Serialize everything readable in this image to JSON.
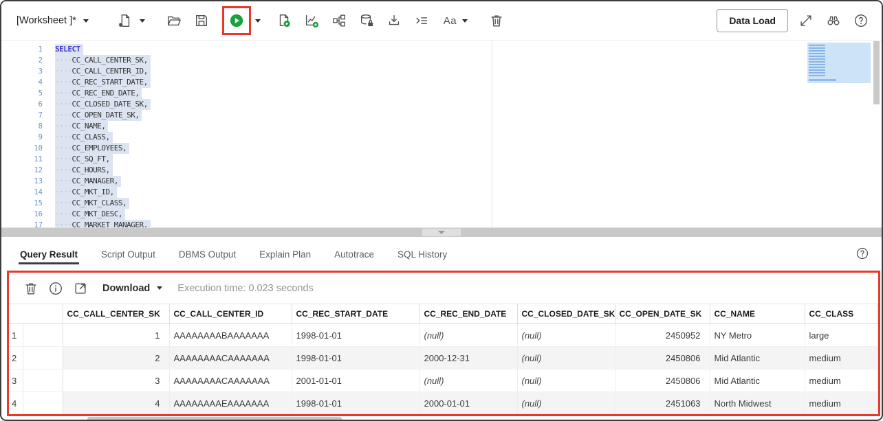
{
  "toolbar": {
    "worksheet_label": "[Worksheet ]*",
    "data_load_label": "Data Load",
    "font_toggle_label": "Aa",
    "icons": [
      "worksheet-dropdown",
      "new-worksheet",
      "open-file",
      "save",
      "run-statement",
      "run-dropdown",
      "run-script",
      "explain-plan",
      "autotrace",
      "dbms-output",
      "download-script",
      "format-code",
      "font-size",
      "clear-worksheet",
      "data-load",
      "expand",
      "find",
      "help"
    ]
  },
  "editor": {
    "indent": "····",
    "lines": [
      {
        "n": "1",
        "text": "SELECT"
      },
      {
        "n": "2",
        "text": "CC_CALL_CENTER_SK,"
      },
      {
        "n": "3",
        "text": "CC_CALL_CENTER_ID,"
      },
      {
        "n": "4",
        "text": "CC_REC_START_DATE,"
      },
      {
        "n": "5",
        "text": "CC_REC_END_DATE,"
      },
      {
        "n": "6",
        "text": "CC_CLOSED_DATE_SK,"
      },
      {
        "n": "7",
        "text": "CC_OPEN_DATE_SK,"
      },
      {
        "n": "8",
        "text": "CC_NAME,"
      },
      {
        "n": "9",
        "text": "CC_CLASS,"
      },
      {
        "n": "10",
        "text": "CC_EMPLOYEES,"
      },
      {
        "n": "11",
        "text": "CC_SQ_FT,"
      },
      {
        "n": "12",
        "text": "CC_HOURS,"
      },
      {
        "n": "13",
        "text": "CC_MANAGER,"
      },
      {
        "n": "14",
        "text": "CC_MKT_ID,"
      },
      {
        "n": "15",
        "text": "CC_MKT_CLASS,"
      },
      {
        "n": "16",
        "text": "CC_MKT_DESC,"
      },
      {
        "n": "17",
        "text": "CC_MARKET_MANAGER,"
      }
    ]
  },
  "tabs": [
    {
      "label": "Query Result",
      "active": true
    },
    {
      "label": "Script Output",
      "active": false
    },
    {
      "label": "DBMS Output",
      "active": false
    },
    {
      "label": "Explain Plan",
      "active": false
    },
    {
      "label": "Autotrace",
      "active": false
    },
    {
      "label": "SQL History",
      "active": false
    }
  ],
  "results_toolbar": {
    "download_label": "Download",
    "execution_time": "Execution time: 0.023 seconds"
  },
  "grid": {
    "columns": [
      "",
      "CC_CALL_CENTER_SK",
      "CC_CALL_CENTER_ID",
      "CC_REC_START_DATE",
      "CC_REC_END_DATE",
      "CC_CLOSED_DATE_SK",
      "CC_OPEN_DATE_SK",
      "CC_NAME",
      "CC_CLASS"
    ],
    "rows": [
      [
        "1",
        "1",
        "AAAAAAAABAAAAAAA",
        "1998-01-01",
        "(null)",
        "(null)",
        "2450952",
        "NY Metro",
        "large"
      ],
      [
        "2",
        "2",
        "AAAAAAAACAAAAAAA",
        "1998-01-01",
        "2000-12-31",
        "(null)",
        "2450806",
        "Mid Atlantic",
        "medium"
      ],
      [
        "3",
        "3",
        "AAAAAAAACAAAAAAA",
        "2001-01-01",
        "(null)",
        "(null)",
        "2450806",
        "Mid Atlantic",
        "medium"
      ],
      [
        "4",
        "4",
        "AAAAAAAAEAAAAAAA",
        "1998-01-01",
        "2000-01-01",
        "(null)",
        "2451063",
        "North Midwest",
        "medium"
      ]
    ]
  },
  "colors": {
    "annotation_red": "#e6392b",
    "run_green": "#17a23c",
    "selection_highlight": "#dce4f1",
    "keyword_blue": "#3d34cc",
    "line_number_blue": "#6a92c2",
    "row_stripe": "#f4f4f4",
    "minimap_blue": "#cde3f8"
  }
}
